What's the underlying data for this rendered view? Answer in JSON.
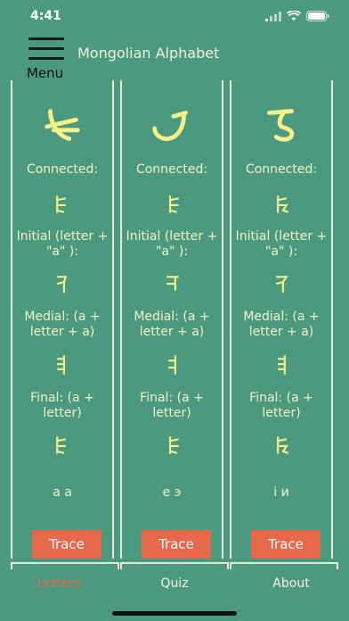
{
  "status": {
    "time": "4:41"
  },
  "header": {
    "menu_label": "Menu",
    "title": "Mongolian Alphabet"
  },
  "columns": [
    {
      "connected_label": "Connected:",
      "initial_label": "Initial (letter + \"a\" ):",
      "medial_label": "Medial: (a + letter + a)",
      "final_label": "Final: (a + letter)",
      "romanization": "a а",
      "trace_label": "Trace"
    },
    {
      "connected_label": "Connected:",
      "initial_label": "Initial (letter + \"a\" ):",
      "medial_label": "Medial: (a + letter + a)",
      "final_label": "Final: (a + letter)",
      "romanization": "e э",
      "trace_label": "Trace"
    },
    {
      "connected_label": "Connected:",
      "initial_label": "Initial (letter + \"a\" ):",
      "medial_label": "Medial: (a + letter + a)",
      "final_label": "Final: (a + letter)",
      "romanization": "i и",
      "trace_label": "Trace"
    }
  ],
  "tabs": [
    {
      "label": "Letters",
      "active": true
    },
    {
      "label": "Quiz",
      "active": false
    },
    {
      "label": "About",
      "active": false
    }
  ],
  "colors": {
    "background": "#4b9a80",
    "accent": "#e8684c",
    "text": "#f2f2c4",
    "glyph": "#f5f08a"
  }
}
